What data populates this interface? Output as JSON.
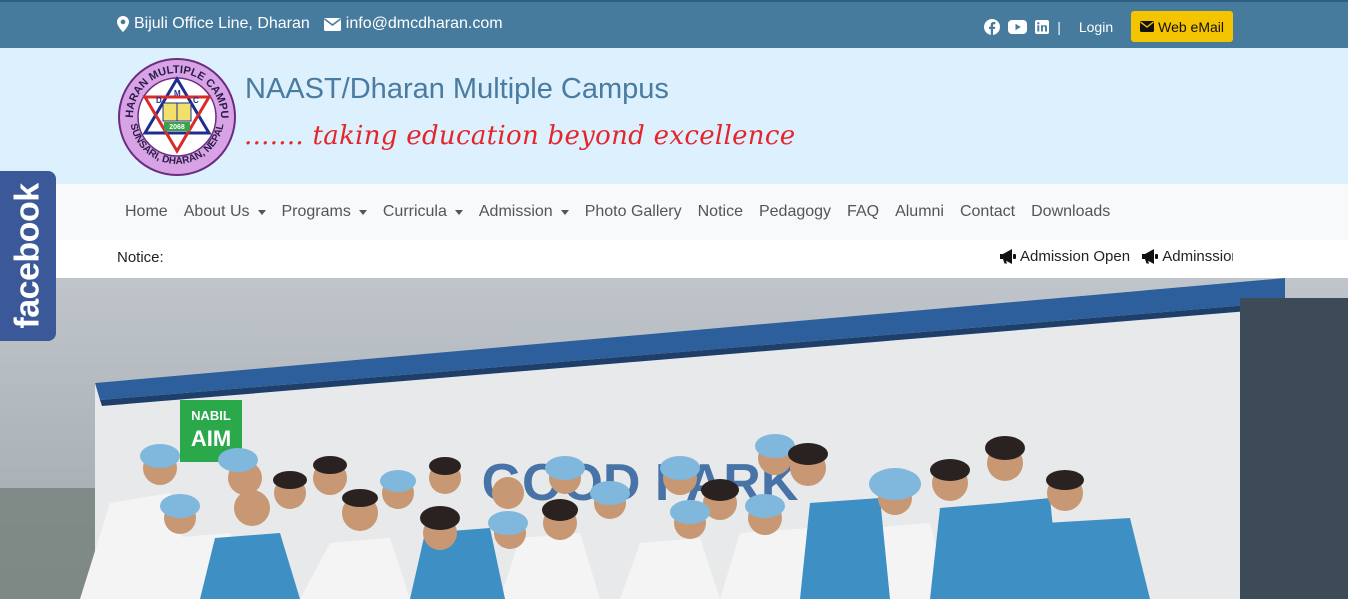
{
  "topbar": {
    "address": "Bijuli Office Line, Dharan",
    "email": "info@dmcdharan.com",
    "separator": "|",
    "login_label": "Login",
    "webmail_label": "Web eMail",
    "social_icons": [
      "facebook-icon",
      "youtube-icon",
      "linkedin-icon"
    ]
  },
  "header": {
    "site_title": "NAAST/Dharan Multiple Campus",
    "tagline": "....... taking education beyond excellence",
    "logo": {
      "ring_text_top": "DHARAN MULTIPLE CAMPUS",
      "ring_text_bottom": "SUNSARI, DHARAN, NEPAL",
      "year": "2068",
      "initials": [
        "D",
        "M",
        "C"
      ]
    }
  },
  "nav": {
    "items": [
      {
        "label": "Home",
        "dropdown": false
      },
      {
        "label": "About Us",
        "dropdown": true
      },
      {
        "label": "Programs",
        "dropdown": true
      },
      {
        "label": "Curricula",
        "dropdown": true
      },
      {
        "label": "Admission",
        "dropdown": true
      },
      {
        "label": "Photo Gallery",
        "dropdown": false
      },
      {
        "label": "Notice",
        "dropdown": false
      },
      {
        "label": "Pedagogy",
        "dropdown": false
      },
      {
        "label": "FAQ",
        "dropdown": false
      },
      {
        "label": "Alumni",
        "dropdown": false
      },
      {
        "label": "Contact",
        "dropdown": false
      },
      {
        "label": "Downloads",
        "dropdown": false
      }
    ]
  },
  "notice": {
    "label": "Notice:",
    "items": [
      "Admission Open",
      "Adminssion"
    ]
  },
  "hero": {
    "sign_bank": "NABIL",
    "sign_atm": "AIM",
    "sign_wall": "GOOD PARK"
  },
  "facebook_tab": {
    "label": "facebook"
  },
  "colors": {
    "topbar_bg": "#477b9d",
    "header_bg": "#dcf0fd",
    "title_color": "#4a7ba0",
    "tagline_color": "#e4262c",
    "webmail_bg": "#f5c400",
    "facebook_bg": "#3b5998"
  }
}
